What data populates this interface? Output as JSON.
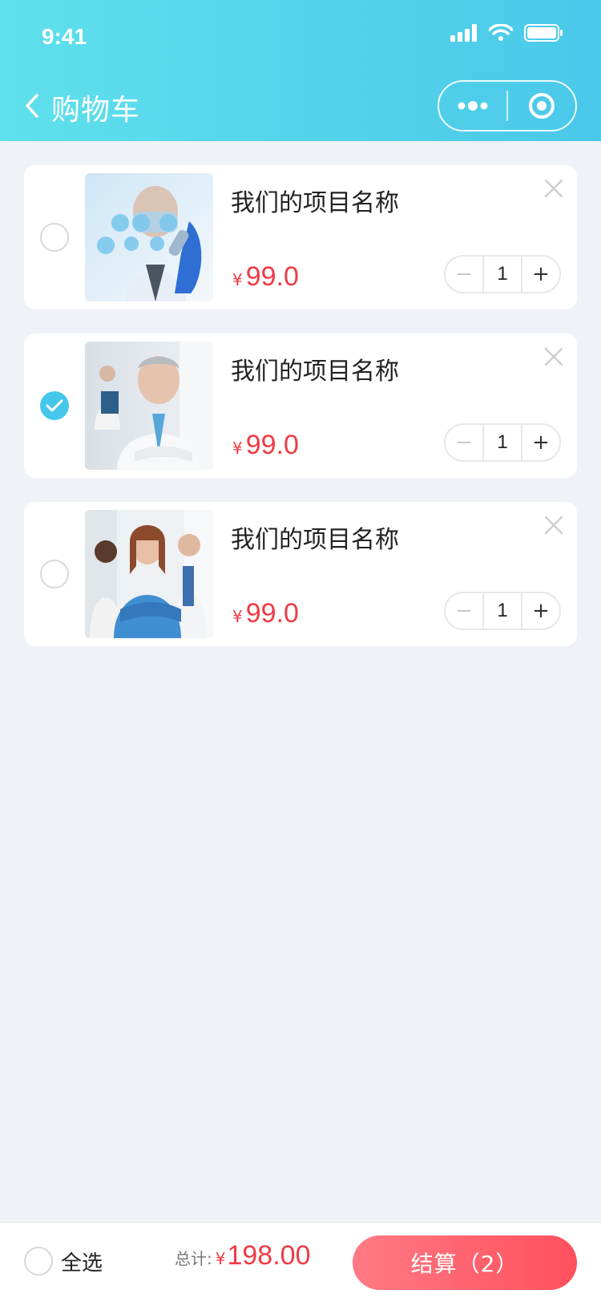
{
  "status_bar": {
    "time": "9:41"
  },
  "nav": {
    "title": "购物车",
    "back_icon": "chevron-left-icon",
    "more_icon": "more-dots-icon",
    "target_icon": "target-icon"
  },
  "items": [
    {
      "name": "我们的项目名称",
      "currency": "¥",
      "price": "99.0",
      "quantity": "1",
      "selected": false,
      "image": "doctor-lab-tech-photo"
    },
    {
      "name": "我们的项目名称",
      "currency": "¥",
      "price": "99.0",
      "quantity": "1",
      "selected": true,
      "image": "senior-doctor-photo"
    },
    {
      "name": "我们的项目名称",
      "currency": "¥",
      "price": "99.0",
      "quantity": "1",
      "selected": false,
      "image": "medical-team-photo"
    }
  ],
  "stepper": {
    "minus": "−",
    "plus": "+"
  },
  "bottom_bar": {
    "select_all_label": "全选",
    "total_label": "总计:",
    "currency": "¥",
    "total_amount": "198.00",
    "checkout_label": "结算（2）"
  },
  "colors": {
    "header_start": "#5fe0ec",
    "header_end": "#4ac8ea",
    "accent_check": "#45c7eb",
    "price_red": "#ef3b45",
    "checkout_start": "#ff7a85",
    "checkout_end": "#ff4f5c"
  }
}
